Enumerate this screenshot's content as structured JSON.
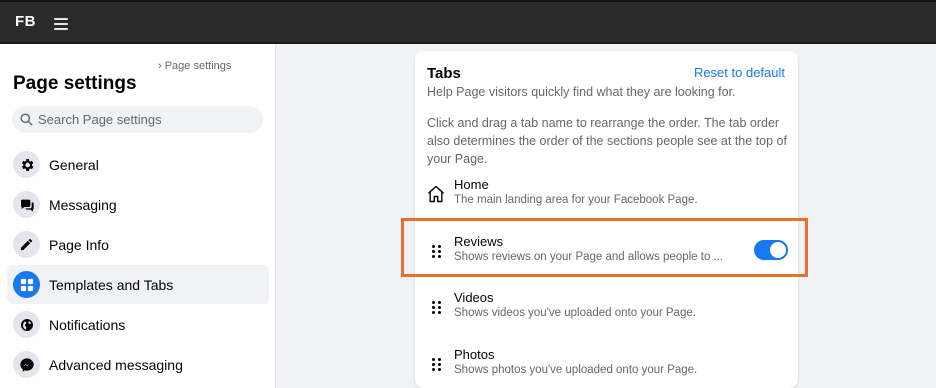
{
  "topbar": {
    "logo": "FB"
  },
  "sidebar": {
    "breadcrumb": "› Page settings",
    "title": "Page settings",
    "search_placeholder": "Search Page settings",
    "items": [
      {
        "label": "General",
        "icon": "gear-icon"
      },
      {
        "label": "Messaging",
        "icon": "chat-icon"
      },
      {
        "label": "Page Info",
        "icon": "pencil-icon"
      },
      {
        "label": "Templates and Tabs",
        "icon": "grid-icon",
        "active": true
      },
      {
        "label": "Notifications",
        "icon": "globe-icon"
      },
      {
        "label": "Advanced messaging",
        "icon": "messenger-icon"
      }
    ]
  },
  "tabs_card": {
    "title": "Tabs",
    "reset_label": "Reset to default",
    "description": "Help Page visitors quickly find what they are looking for.",
    "instructions": "Click and drag a tab name to rearrange the order. The tab order also determines the order of the sections people see at the top of your Page.",
    "tabs": [
      {
        "name": "Home",
        "description": "The main landing area for your Facebook Page.",
        "icon": "home-icon"
      },
      {
        "name": "Reviews",
        "description": "Shows reviews on your Page and allows people to ...",
        "icon": "drag-handle-icon",
        "toggle": true
      },
      {
        "name": "Videos",
        "description": "Shows videos you've uploaded onto your Page.",
        "icon": "drag-handle-icon"
      },
      {
        "name": "Photos",
        "description": "Shows photos you've uploaded onto your Page.",
        "icon": "drag-handle-icon"
      }
    ]
  },
  "colors": {
    "accent": "#1877f2",
    "highlight": "#e8702a",
    "topbar": "#2b2b2b"
  }
}
